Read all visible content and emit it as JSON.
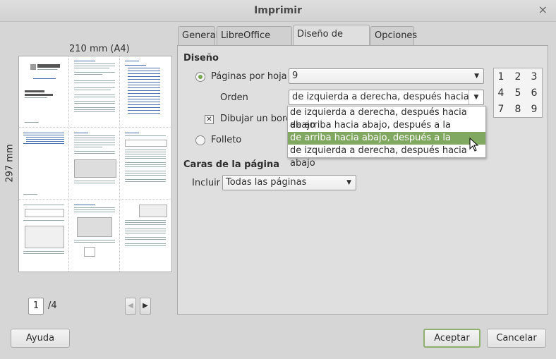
{
  "window": {
    "title": "Imprimir",
    "close_glyph": "×"
  },
  "preview": {
    "paper_size": "210 mm (A4)",
    "paper_height": "297 mm",
    "page_current": "1",
    "page_total": "/4"
  },
  "tabs": [
    {
      "label": "General"
    },
    {
      "label": "LibreOffice Writer"
    },
    {
      "label": "Diseño de página"
    },
    {
      "label": "Opciones"
    }
  ],
  "layout": {
    "section_title": "Diseño",
    "pages_per_sheet_label": "Páginas por hoja",
    "pages_per_sheet_value": "9",
    "order_label": "Orden",
    "order_value": "de izquierda a derecha, después hacia abajo",
    "draw_border_label": "Dibujar un borde",
    "brochure_label": "Folleto",
    "grid": [
      "1",
      "2",
      "3",
      "4",
      "5",
      "6",
      "7",
      "8",
      "9"
    ],
    "order_options": [
      "de izquierda a derecha, después hacia abajo",
      "de arriba hacia abajo, después a la derecha",
      "de arriba hacia abajo, después a la derecha",
      "de izquierda a derecha, después hacia abajo"
    ]
  },
  "sides": {
    "section_title": "Caras de la página",
    "include_label": "Incluir",
    "include_value": "Todas las páginas"
  },
  "buttons": {
    "help": "Ayuda",
    "ok": "Aceptar",
    "cancel": "Cancelar"
  },
  "colors": {
    "accent": "#80a861"
  }
}
